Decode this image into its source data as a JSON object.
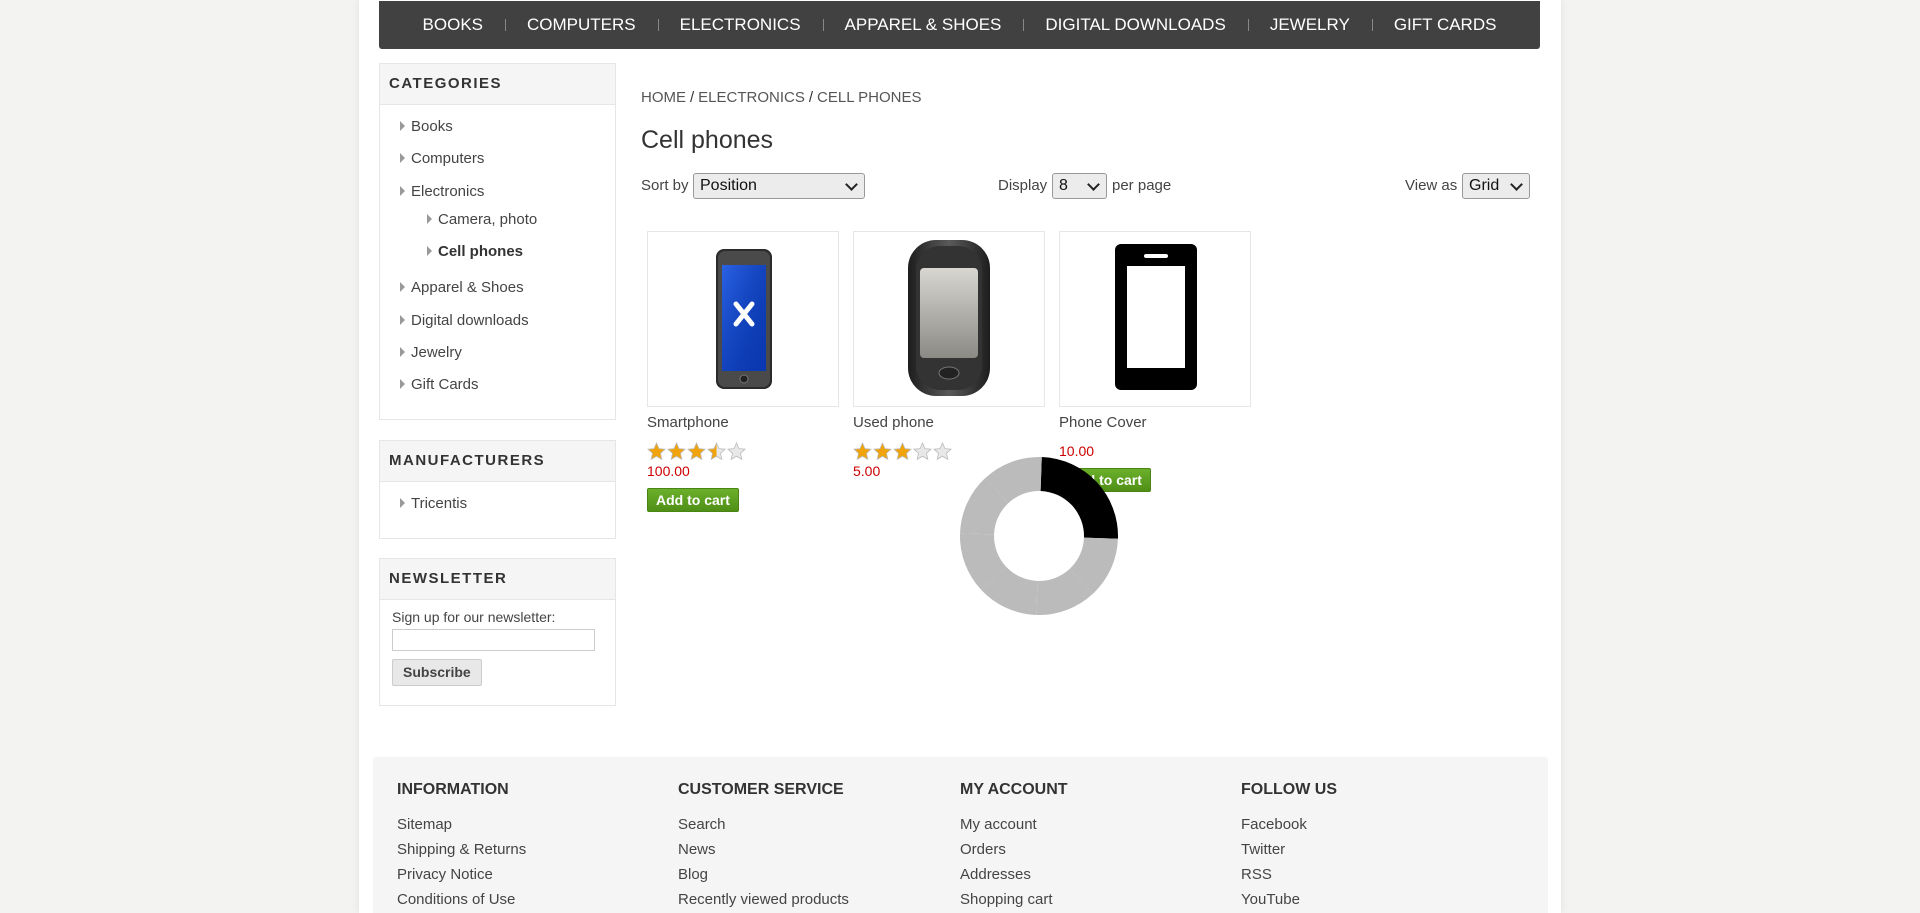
{
  "top_menu": [
    "Books",
    "Computers",
    "Electronics",
    "Apparel & Shoes",
    "Digital downloads",
    "Jewelry",
    "Gift Cards"
  ],
  "categories": {
    "title": "Categories",
    "items": [
      "Books",
      "Computers",
      "Electronics",
      "Camera, photo",
      "Cell phones",
      "Apparel & Shoes",
      "Digital downloads",
      "Jewelry",
      "Gift Cards"
    ]
  },
  "manufacturers": {
    "title": "Manufacturers",
    "items": [
      "Tricentis"
    ]
  },
  "newsletter": {
    "title": "Newsletter",
    "label": "Sign up for our newsletter:",
    "input_value": "",
    "button": "Subscribe"
  },
  "breadcrumb": {
    "home": "Home",
    "sep": "/",
    "electronics": "Electronics",
    "current": "Cell phones"
  },
  "page_title": "Cell phones",
  "controls": {
    "sort_label": "Sort by",
    "sort_value": "Position",
    "display_label": "Display",
    "display_value": "8",
    "per_page": "per page",
    "view_label": "View as",
    "view_value": "Grid"
  },
  "products": [
    {
      "name": "Smartphone",
      "rating_stars": 3.5,
      "price": "100.00",
      "button": "Add to cart"
    },
    {
      "name": "Used phone",
      "rating_stars": 3,
      "price": "5.00"
    },
    {
      "name": "Phone Cover",
      "price": "10.00",
      "button": "Add to cart"
    }
  ],
  "footer": {
    "columns": [
      {
        "title": "Information",
        "links": [
          "Sitemap",
          "Shipping & Returns",
          "Privacy Notice",
          "Conditions of Use"
        ]
      },
      {
        "title": "Customer service",
        "links": [
          "Search",
          "News",
          "Blog",
          "Recently viewed products"
        ]
      },
      {
        "title": "My account",
        "links": [
          "My account",
          "Orders",
          "Addresses",
          "Shopping cart"
        ]
      },
      {
        "title": "Follow us",
        "links": [
          "Facebook",
          "Twitter",
          "RSS",
          "YouTube"
        ]
      }
    ]
  },
  "colors": {
    "menu_bg": "#414141",
    "price": "#cc0000",
    "cart_button": "#5a9e1f",
    "star": "#f0a30a"
  }
}
